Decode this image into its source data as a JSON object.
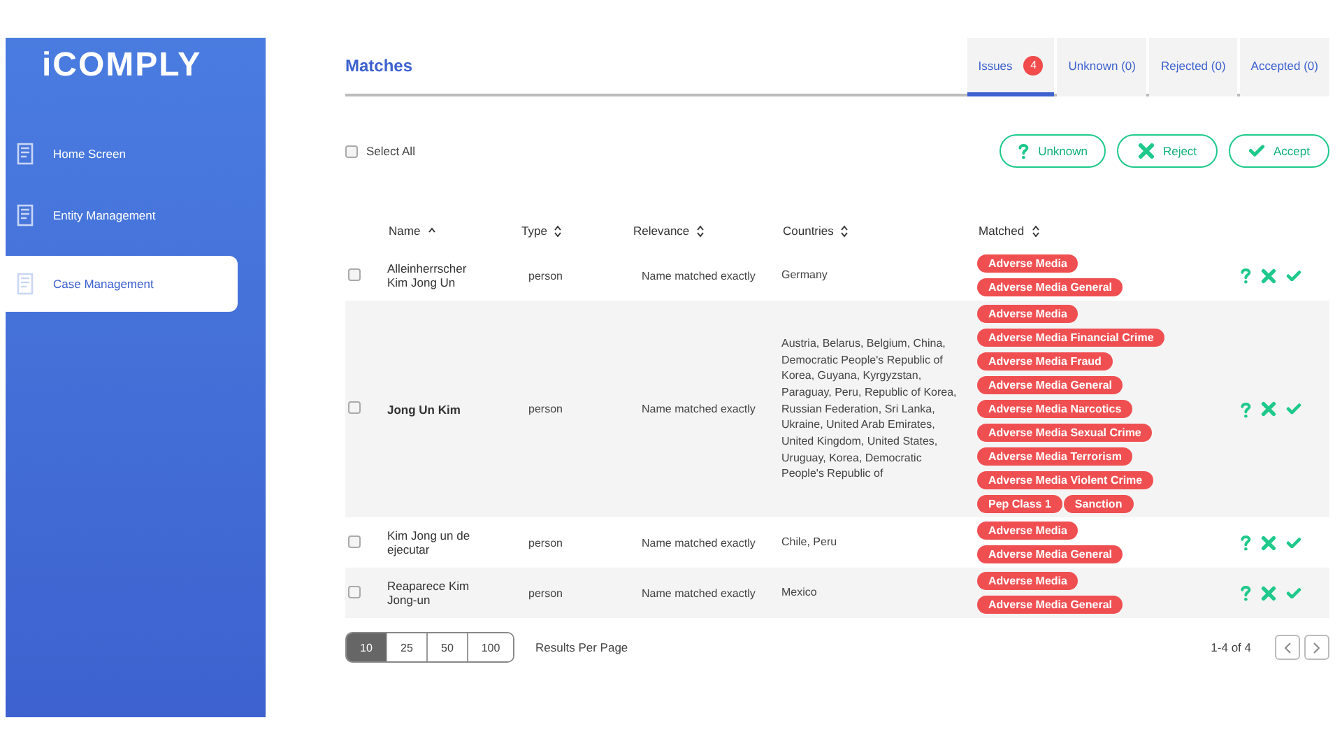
{
  "sidebar": {
    "logo": "iCOMPLY",
    "items": [
      {
        "label": "Home Screen",
        "selected": false
      },
      {
        "label": "Entity Management",
        "selected": false
      },
      {
        "label": "Case Management",
        "selected": true
      }
    ]
  },
  "header": {
    "title": "Matches",
    "tabs": [
      {
        "label": "Issues",
        "badge": "4",
        "selected": true
      },
      {
        "label": "Unknown (0)",
        "selected": false
      },
      {
        "label": "Rejected (0)",
        "selected": false
      },
      {
        "label": "Accepted (0)",
        "selected": false
      }
    ]
  },
  "toolbar": {
    "select_all": {
      "label": "Select All",
      "checked": false
    },
    "buttons": [
      {
        "kind": "unknown",
        "label": "Unknown"
      },
      {
        "kind": "reject",
        "label": "Reject"
      },
      {
        "kind": "accept",
        "label": "Accept"
      }
    ]
  },
  "table": {
    "columns": [
      {
        "label": "Name",
        "sorted": true
      },
      {
        "label": "Type",
        "sorted": false
      },
      {
        "label": "Relevance",
        "sorted": false
      },
      {
        "label": "Countries",
        "sorted": false
      },
      {
        "label": "Matched",
        "sorted": false
      }
    ],
    "rows": [
      {
        "checked": false,
        "name": "Alleinherrscher Kim Jong Un",
        "bold": false,
        "type": "person",
        "relevance": "Name matched exactly",
        "countries": "Germany",
        "matched": [
          "Adverse Media",
          "Adverse Media General"
        ]
      },
      {
        "checked": false,
        "name": "Jong Un Kim",
        "bold": true,
        "type": "person",
        "relevance": "Name matched exactly",
        "countries": "Austria, Belarus, Belgium, China, Democratic People's Republic of Korea, Guyana, Kyrgyzstan, Paraguay, Peru, Republic of Korea, Russian Federation, Sri Lanka, Ukraine, United Arab Emirates, United Kingdom, United States, Uruguay, Korea, Democratic People's Republic of",
        "matched": [
          "Adverse Media",
          "Adverse Media Financial Crime",
          "Adverse Media Fraud",
          "Adverse Media General",
          "Adverse Media Narcotics",
          "Adverse Media Sexual Crime",
          "Adverse Media Terrorism",
          "Adverse Media Violent Crime",
          "Pep Class 1",
          "Sanction"
        ]
      },
      {
        "checked": false,
        "name": "Kim Jong un de ejecutar",
        "bold": false,
        "type": "person",
        "relevance": "Name matched exactly",
        "countries": "Chile, Peru",
        "matched": [
          "Adverse Media",
          "Adverse Media General"
        ]
      },
      {
        "checked": false,
        "name": "Reaparece Kim Jong-un",
        "bold": false,
        "type": "person",
        "relevance": "Name matched exactly",
        "countries": "Mexico",
        "matched": [
          "Adverse Media",
          "Adverse Media General"
        ]
      }
    ]
  },
  "footer": {
    "page_sizes": [
      {
        "label": "10",
        "selected": true
      },
      {
        "label": "25",
        "selected": false
      },
      {
        "label": "50",
        "selected": false
      },
      {
        "label": "100",
        "selected": false
      }
    ],
    "page_size_label": "Results Per Page",
    "range": "1-4 of 4"
  }
}
